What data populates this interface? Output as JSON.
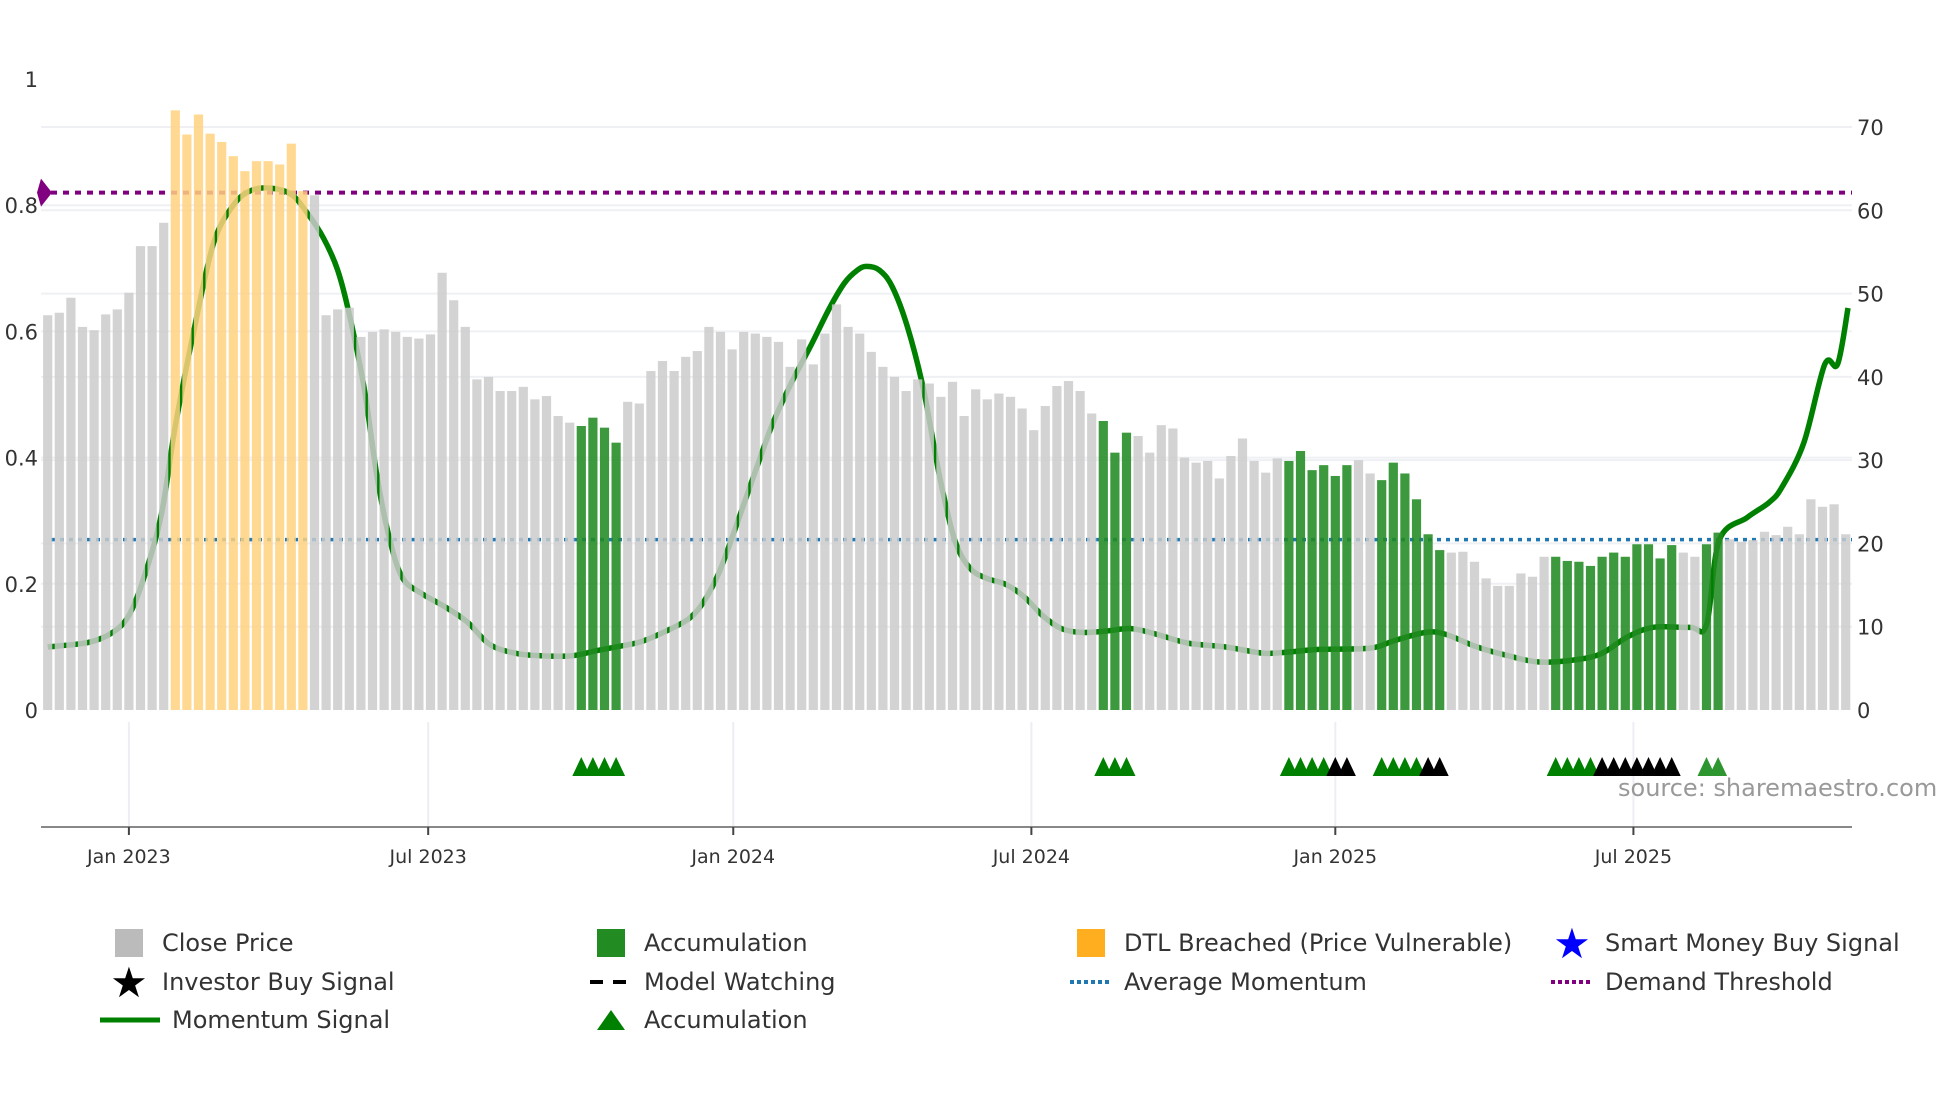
{
  "chart_data": {
    "type": "bar",
    "title": "",
    "xlabel": "",
    "ylabel_left": "",
    "ylabel_right": "",
    "left_axis": {
      "range": [
        0,
        1
      ],
      "ticks": [
        0,
        0.2,
        0.4,
        0.6,
        0.8,
        1
      ],
      "tick_labels": [
        "0",
        "0.2",
        "0.4",
        "0.6",
        "0.8",
        "1"
      ]
    },
    "right_axis": {
      "range": [
        0,
        70
      ],
      "ticks": [
        0,
        10,
        20,
        30,
        40,
        50,
        60,
        70
      ],
      "tick_labels": [
        "0",
        "10",
        "20",
        "30",
        "40",
        "50",
        "60",
        "70"
      ]
    },
    "x_ticks": [
      {
        "label": "Jan 2023",
        "week": 8.0
      },
      {
        "label": "Jul 2023",
        "week": 33.8
      },
      {
        "label": "Jan 2024",
        "week": 60.1
      },
      {
        "label": "Jul 2024",
        "week": 85.8
      },
      {
        "label": "Jan 2025",
        "week": 112.0
      },
      {
        "label": "Jul 2025",
        "week": 137.7
      }
    ],
    "close_price": [
      47.4,
      47.7,
      49.5,
      46,
      45.6,
      47.5,
      48.1,
      50.1,
      55.7,
      55.7,
      58.5,
      72,
      69.1,
      71.5,
      69.2,
      68.2,
      66.5,
      64.7,
      65.9,
      65.9,
      65.5,
      68,
      62.3,
      61.8,
      47.4,
      48.1,
      48.3,
      44.8,
      45.4,
      45.7,
      45.4,
      44.8,
      44.6,
      45.1,
      52.5,
      49.2,
      46,
      39.7,
      40,
      38.3,
      38.3,
      38.8,
      37.3,
      37.7,
      35.3,
      34.5,
      34.1,
      35.1,
      33.9,
      32.1,
      37,
      36.8,
      40.7,
      41.9,
      40.7,
      42.4,
      43.1,
      46,
      45.4,
      43.3,
      45.4,
      45.2,
      44.8,
      44.2,
      41.2,
      44.5,
      41.5,
      45.2,
      48.7,
      46,
      45.2,
      43,
      41.2,
      40,
      38.3,
      39.7,
      39.2,
      37.6,
      39.4,
      35.3,
      38.5,
      37.3,
      38,
      37.6,
      36.2,
      33.6,
      36.5,
      38.9,
      39.5,
      38.3,
      35.6,
      34.7,
      30.9,
      33.3,
      32.9,
      30.9,
      34.2,
      33.8,
      30.3,
      29.7,
      29.9,
      27.8,
      30.5,
      32.6,
      29.9,
      28.5,
      30.2,
      29.9,
      31.1,
      28.8,
      29.4,
      28.1,
      29.4,
      30,
      28.4,
      27.6,
      29.7,
      28.4,
      25.3,
      21.1,
      19.2,
      18.9,
      19,
      17.8,
      15.8,
      14.9,
      14.9,
      16.4,
      16,
      18.4,
      18.4,
      17.9,
      17.8,
      17.3,
      18.4,
      18.9,
      18.4,
      19.9,
      19.9,
      18.2,
      19.8,
      18.9,
      18.4,
      19.9,
      21.3,
      20.5,
      20.2,
      20.4,
      21.4,
      21,
      22,
      21.1,
      25.3,
      24.4,
      24.7,
      21.1
    ],
    "dtl_breached_weeks": [
      12,
      13,
      14,
      15,
      16,
      17,
      18,
      19,
      20,
      21,
      22,
      23
    ],
    "accumulation_weeks": [
      47,
      48,
      49,
      50,
      92,
      93,
      94,
      108,
      109,
      110,
      111,
      112,
      113,
      116,
      117,
      118,
      119,
      120,
      121,
      131,
      132,
      133,
      134,
      135,
      136,
      137,
      138,
      139,
      140,
      141,
      144,
      145
    ],
    "momentum_signal": [
      [
        1,
        0.1
      ],
      [
        4.5,
        0.107
      ],
      [
        6.6,
        0.123
      ],
      [
        8,
        0.15
      ],
      [
        9.3,
        0.21
      ],
      [
        10.8,
        0.31
      ],
      [
        12,
        0.45
      ],
      [
        13.7,
        0.61
      ],
      [
        15.3,
        0.74
      ],
      [
        17,
        0.8
      ],
      [
        18.5,
        0.823
      ],
      [
        20.2,
        0.827
      ],
      [
        22,
        0.817
      ],
      [
        23.4,
        0.787
      ],
      [
        24.8,
        0.747
      ],
      [
        26,
        0.697
      ],
      [
        27,
        0.627
      ],
      [
        28.3,
        0.508
      ],
      [
        29.4,
        0.369
      ],
      [
        30.5,
        0.269
      ],
      [
        31.6,
        0.209
      ],
      [
        33.2,
        0.185
      ],
      [
        35.3,
        0.163
      ],
      [
        37.2,
        0.139
      ],
      [
        39.1,
        0.104
      ],
      [
        41.3,
        0.09
      ],
      [
        43.5,
        0.086
      ],
      [
        46.2,
        0.086
      ],
      [
        48.3,
        0.094
      ],
      [
        50,
        0.1
      ],
      [
        52.1,
        0.108
      ],
      [
        54.3,
        0.125
      ],
      [
        56.3,
        0.145
      ],
      [
        57.6,
        0.173
      ],
      [
        58.9,
        0.219
      ],
      [
        60.3,
        0.289
      ],
      [
        62,
        0.378
      ],
      [
        63.5,
        0.454
      ],
      [
        65.1,
        0.518
      ],
      [
        66.8,
        0.578
      ],
      [
        68.4,
        0.637
      ],
      [
        69.7,
        0.677
      ],
      [
        70.8,
        0.697
      ],
      [
        71.6,
        0.703
      ],
      [
        72.7,
        0.697
      ],
      [
        73.8,
        0.671
      ],
      [
        75.1,
        0.608
      ],
      [
        76.5,
        0.508
      ],
      [
        77.9,
        0.369
      ],
      [
        79.2,
        0.269
      ],
      [
        80.5,
        0.225
      ],
      [
        81.9,
        0.209
      ],
      [
        83.6,
        0.199
      ],
      [
        85.2,
        0.179
      ],
      [
        86.8,
        0.149
      ],
      [
        88.4,
        0.129
      ],
      [
        90.1,
        0.123
      ],
      [
        92.2,
        0.125
      ],
      [
        94.4,
        0.129
      ],
      [
        96.6,
        0.12
      ],
      [
        99.3,
        0.106
      ],
      [
        102.5,
        0.1
      ],
      [
        105.8,
        0.09
      ],
      [
        108,
        0.092
      ],
      [
        110.6,
        0.096
      ],
      [
        115,
        0.098
      ],
      [
        117.1,
        0.11
      ],
      [
        119.8,
        0.123
      ],
      [
        121.5,
        0.12
      ],
      [
        124.2,
        0.1
      ],
      [
        126.9,
        0.086
      ],
      [
        129.6,
        0.076
      ],
      [
        132.9,
        0.08
      ],
      [
        135,
        0.09
      ],
      [
        137.2,
        0.116
      ],
      [
        139.4,
        0.131
      ],
      [
        142.6,
        0.131
      ],
      [
        144,
        0.135
      ],
      [
        145.1,
        0.269
      ],
      [
        147.5,
        0.305
      ],
      [
        149.4,
        0.329
      ],
      [
        150.5,
        0.353
      ],
      [
        152.4,
        0.424
      ],
      [
        154.2,
        0.548
      ],
      [
        155.3,
        0.548
      ],
      [
        156.2,
        0.637
      ]
    ],
    "average_momentum": 0.27,
    "demand_threshold": 0.82,
    "accumulation_markers": [
      47,
      48,
      49,
      50,
      92,
      93,
      94,
      108,
      109,
      110,
      111,
      116,
      117,
      118,
      119,
      131,
      132,
      133,
      134,
      144,
      145
    ],
    "investor_buy_markers": [
      112,
      113,
      120,
      121,
      135,
      136,
      137,
      138,
      139,
      140,
      141
    ],
    "colors": {
      "close": "#cbcbcb",
      "accumulation_bar": "#228b22",
      "dtl": "#ffd27f",
      "momentum": "#008000",
      "average": "#1f77b4",
      "threshold": "#800080",
      "investor": "#000000",
      "smart_money": "#0000ff"
    },
    "legend": [
      {
        "label": "Close Price",
        "icon": "gray-bar"
      },
      {
        "label": "Accumulation",
        "icon": "green-bar"
      },
      {
        "label": "DTL Breached (Price Vulnerable)",
        "icon": "orange-bar"
      },
      {
        "label": "Smart Money Buy Signal",
        "icon": "blue-star"
      },
      {
        "label": "Investor Buy Signal",
        "icon": "black-star"
      },
      {
        "label": "Model Watching",
        "icon": "black-dash"
      },
      {
        "label": "Average Momentum",
        "icon": "blue-dot-line"
      },
      {
        "label": "Demand Threshold",
        "icon": "purple-dot-line"
      },
      {
        "label": "Momentum Signal",
        "icon": "green-line"
      },
      {
        "label": "Accumulation",
        "icon": "green-triangle"
      }
    ],
    "source": "source: sharemaestro.com"
  }
}
